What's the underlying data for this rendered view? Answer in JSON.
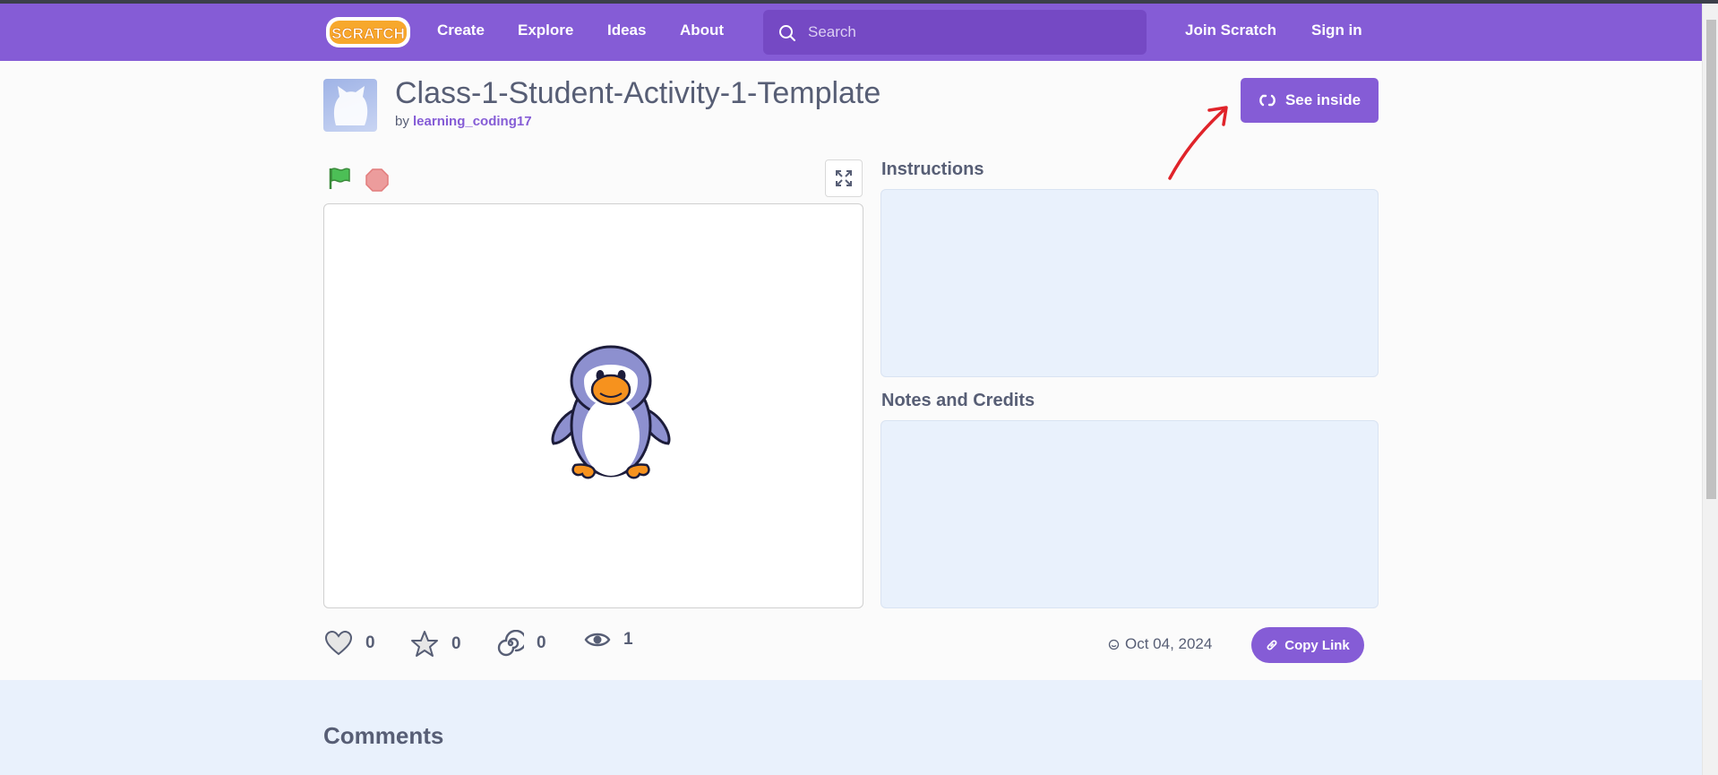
{
  "nav": {
    "logo_text": "SCRATCH",
    "links": [
      "Create",
      "Explore",
      "Ideas",
      "About"
    ],
    "search_placeholder": "Search",
    "join": "Join Scratch",
    "sign_in": "Sign in"
  },
  "project": {
    "title": "Class-1-Student-Activity-1-Template",
    "by_prefix": "by",
    "author": "learning_coding17",
    "see_inside": "See inside"
  },
  "sections": {
    "instructions": "Instructions",
    "notes": "Notes and Credits"
  },
  "stats": {
    "loves": "0",
    "favorites": "0",
    "remixes": "0",
    "views": "1"
  },
  "date": "Oct 04, 2024",
  "copy_link": "Copy Link",
  "comments_title": "Comments",
  "colors": {
    "brand": "#855cd6",
    "panel": "#e9f1fc",
    "text": "#575e75",
    "annotation_arrow": "#e0232a"
  }
}
